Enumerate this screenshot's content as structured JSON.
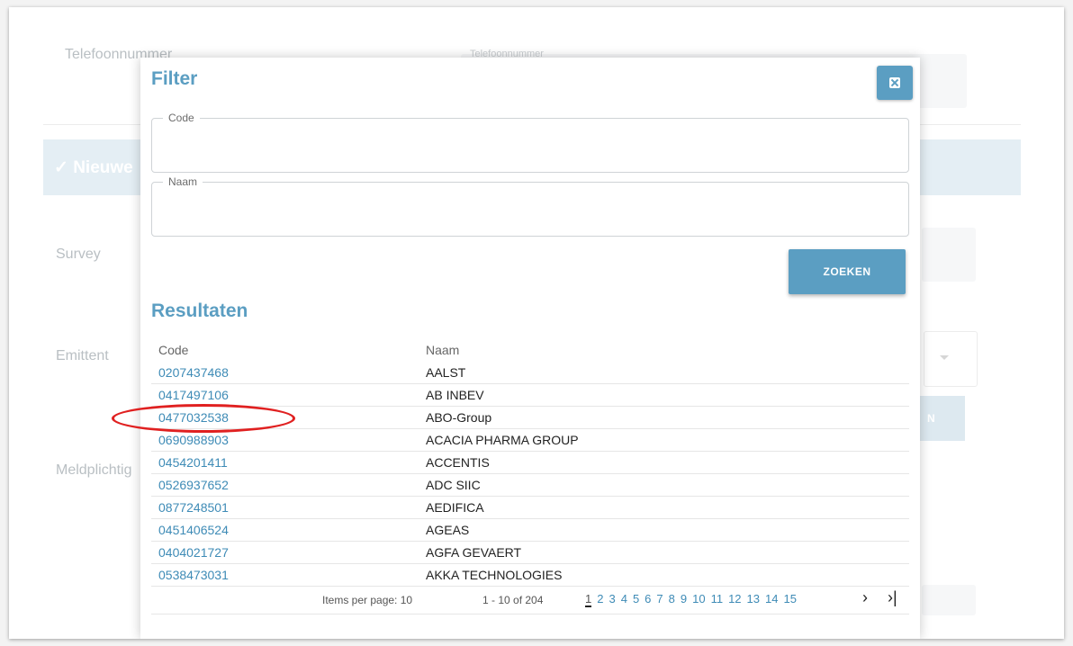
{
  "background": {
    "telefoon_label": "Telefoonnummer",
    "telefoon_placeholder": "Telefoonnummer",
    "banner_text": "✓ Nieuwe",
    "survey_label": "Survey",
    "emittent_label": "Emittent",
    "meldplichtig_label": "Meldplichtig",
    "button_text": "N"
  },
  "modal": {
    "title": "Filter",
    "code_legend": "Code",
    "code_value": "",
    "naam_legend": "Naam",
    "naam_value": "",
    "search_label": "ZOEKEN",
    "results_title": "Resultaten",
    "columns": [
      "Code",
      "Naam"
    ],
    "rows": [
      {
        "code": "0207437468",
        "naam": "AALST"
      },
      {
        "code": "0417497106",
        "naam": "AB INBEV"
      },
      {
        "code": "0477032538",
        "naam": "ABO-Group"
      },
      {
        "code": "0690988903",
        "naam": "ACACIA PHARMA GROUP"
      },
      {
        "code": "0454201411",
        "naam": "ACCENTIS"
      },
      {
        "code": "0526937652",
        "naam": "ADC SIIC"
      },
      {
        "code": "0877248501",
        "naam": "AEDIFICA"
      },
      {
        "code": "0451406524",
        "naam": "AGEAS"
      },
      {
        "code": "0404021727",
        "naam": "AGFA GEVAERT"
      },
      {
        "code": "0538473031",
        "naam": "AKKA TECHNOLOGIES"
      }
    ],
    "pager": {
      "items_per_page": "Items per page: 10",
      "range": "1 - 10 of 204",
      "pages": [
        "1",
        "2",
        "3",
        "4",
        "5",
        "6",
        "7",
        "8",
        "9",
        "10",
        "11",
        "12",
        "13",
        "14",
        "15"
      ],
      "current_page": "1",
      "next": "›",
      "last": "›|"
    }
  },
  "colors": {
    "accent": "#5b9ec2",
    "link": "#3e8bb6",
    "annotation": "#e02020"
  }
}
